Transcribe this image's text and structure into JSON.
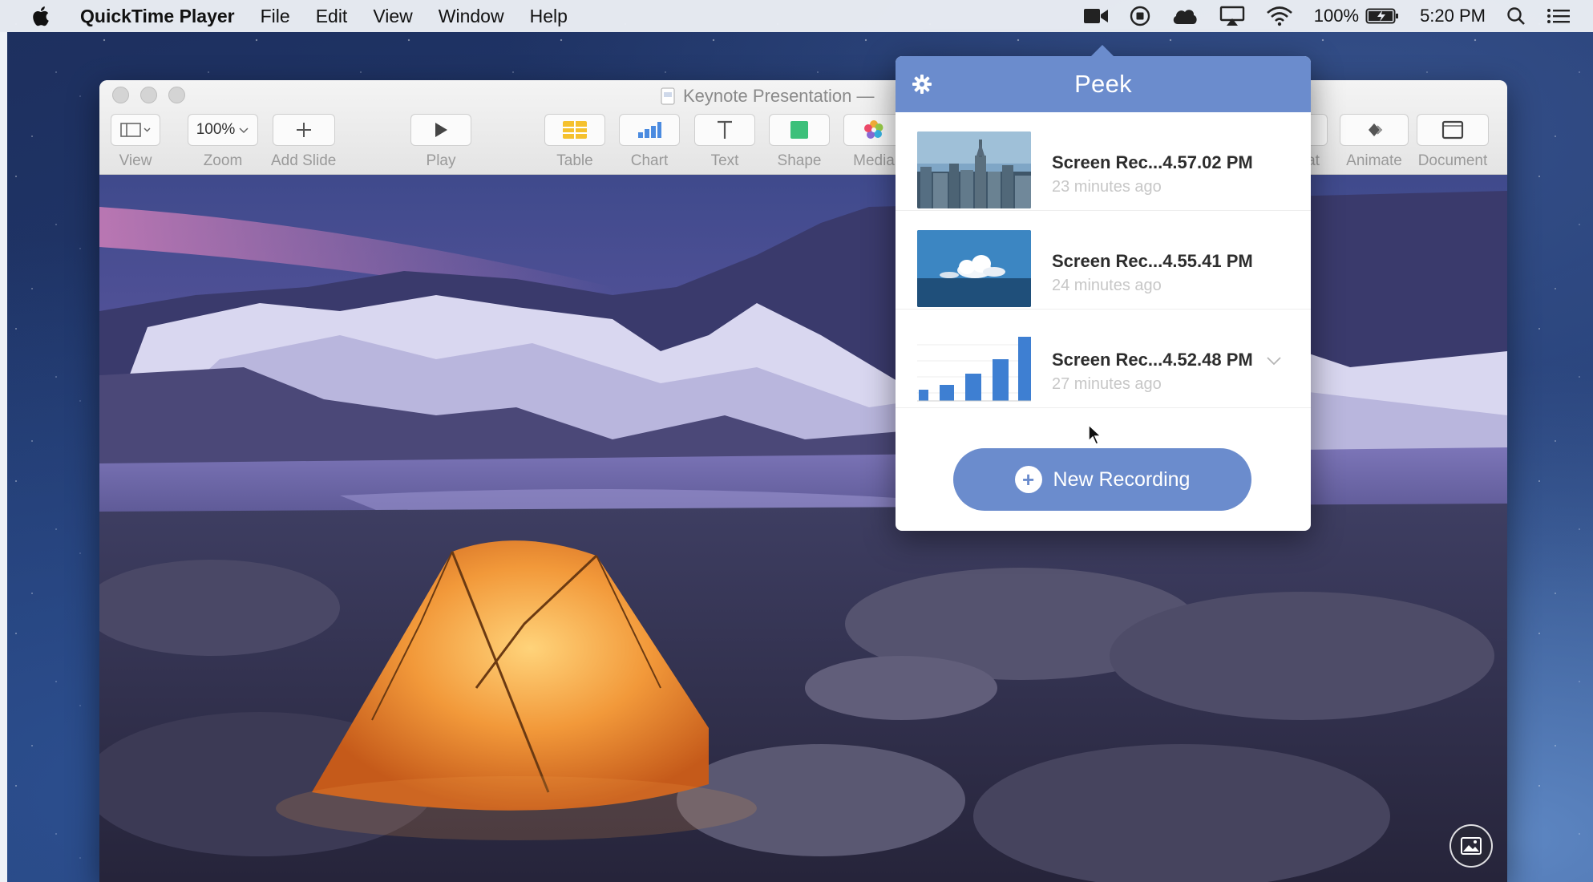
{
  "menubar": {
    "app_name": "QuickTime Player",
    "menus": [
      "File",
      "Edit",
      "View",
      "Window",
      "Help"
    ],
    "battery_percent": "100%",
    "clock": "5:20 PM",
    "status_icons": [
      "camera-icon",
      "record-icon",
      "cloud-icon",
      "airplay-icon",
      "wifi-icon",
      "battery-icon",
      "spotlight-icon",
      "notification-list-icon"
    ]
  },
  "keynote": {
    "title": "Keynote Presentation —",
    "toolbar": {
      "view": "View",
      "zoom_value": "100%",
      "zoom": "Zoom",
      "add_slide": "Add Slide",
      "play": "Play",
      "table": "Table",
      "chart": "Chart",
      "text": "Text",
      "shape": "Shape",
      "media": "Media",
      "format_partial": "at",
      "animate": "Animate",
      "document": "Document"
    }
  },
  "peek": {
    "title": "Peek",
    "recordings": [
      {
        "name": "Screen Rec...4.57.02 PM",
        "time": "23 minutes ago",
        "thumb": "city-skyline"
      },
      {
        "name": "Screen Rec...4.55.41 PM",
        "time": "24 minutes ago",
        "thumb": "ocean-clouds"
      },
      {
        "name": "Screen Rec...4.52.48 PM",
        "time": "27 minutes ago",
        "thumb": "bar-chart"
      }
    ],
    "new_recording": "New Recording"
  },
  "colors": {
    "peek_accent": "#6b8ccd",
    "menubar_bg": "#eceff5"
  }
}
